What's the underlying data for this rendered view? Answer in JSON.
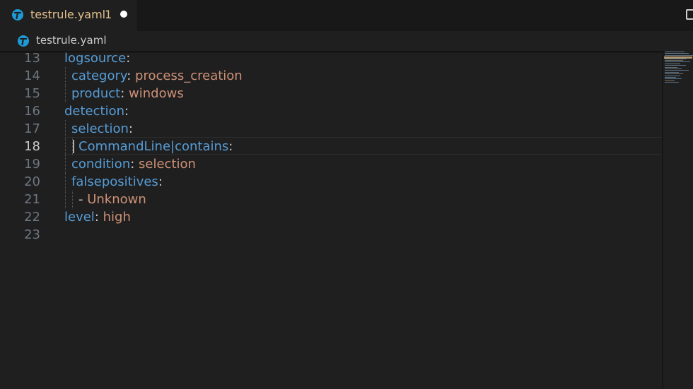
{
  "tab": {
    "label": "testrule.yaml",
    "badge": "1",
    "icon": "yaml-file-icon"
  },
  "breadcrumb": {
    "label": "testrule.yaml",
    "icon": "yaml-file-icon"
  },
  "colors": {
    "key": "#569cd6",
    "value": "#ce9178",
    "punct": "#cccccc",
    "tab_modified": "#e2c08d",
    "line_number": "#6e7681",
    "line_number_active": "#cccccc"
  },
  "editor": {
    "active_line": "18",
    "lines": [
      {
        "num": "13",
        "key": "logsource",
        "sep": ":",
        "value": ""
      },
      {
        "num": "14",
        "key": "category",
        "sep": ": ",
        "value": "process_creation"
      },
      {
        "num": "15",
        "key": "product",
        "sep": ": ",
        "value": "windows"
      },
      {
        "num": "16",
        "key": "detection",
        "sep": ":",
        "value": ""
      },
      {
        "num": "17",
        "key": "selection",
        "sep": ":",
        "value": ""
      },
      {
        "num": "18",
        "key": "CommandLine|contains",
        "sep": ":",
        "value": ""
      },
      {
        "num": "19",
        "key": "condition",
        "sep": ": ",
        "value": "selection"
      },
      {
        "num": "20",
        "key": "falsepositives",
        "sep": ":",
        "value": ""
      },
      {
        "num": "21",
        "key": "",
        "sep": "- ",
        "value": "Unknown"
      },
      {
        "num": "22",
        "key": "level",
        "sep": ": ",
        "value": "high"
      },
      {
        "num": "23",
        "key": "",
        "sep": "",
        "value": ""
      }
    ]
  }
}
